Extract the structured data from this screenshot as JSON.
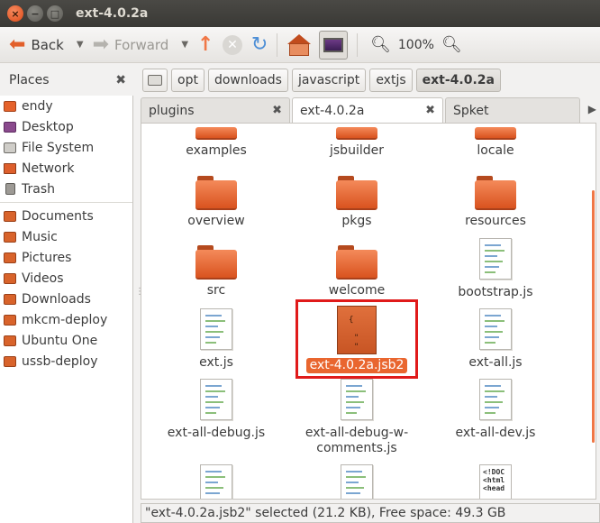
{
  "window": {
    "title": "ext-4.0.2a"
  },
  "toolbar": {
    "back_label": "Back",
    "forward_label": "Forward",
    "zoom_level": "100%"
  },
  "sidebar": {
    "header": "Places",
    "items": [
      {
        "label": "endy",
        "icon": "home-folder-icon"
      },
      {
        "label": "Desktop",
        "icon": "desktop-icon"
      },
      {
        "label": "File System",
        "icon": "harddisk-icon"
      },
      {
        "label": "Network",
        "icon": "network-icon"
      },
      {
        "label": "Trash",
        "icon": "trash-icon"
      }
    ],
    "bookmarks": [
      {
        "label": "Documents"
      },
      {
        "label": "Music"
      },
      {
        "label": "Pictures"
      },
      {
        "label": "Videos"
      },
      {
        "label": "Downloads"
      },
      {
        "label": "mkcm-deploy"
      },
      {
        "label": "Ubuntu One"
      },
      {
        "label": "ussb-deploy"
      }
    ]
  },
  "pathbar": {
    "crumbs": [
      "opt",
      "downloads",
      "javascript",
      "extjs",
      "ext-4.0.2a"
    ]
  },
  "tabs": [
    {
      "label": "plugins"
    },
    {
      "label": "ext-4.0.2a"
    },
    {
      "label": "Spket"
    }
  ],
  "files": [
    {
      "name": "examples",
      "type": "folder"
    },
    {
      "name": "jsbuilder",
      "type": "folder"
    },
    {
      "name": "locale",
      "type": "folder"
    },
    {
      "name": "overview",
      "type": "folder"
    },
    {
      "name": "pkgs",
      "type": "folder"
    },
    {
      "name": "resources",
      "type": "folder"
    },
    {
      "name": "src",
      "type": "folder"
    },
    {
      "name": "welcome",
      "type": "folder"
    },
    {
      "name": "bootstrap.js",
      "type": "js"
    },
    {
      "name": "ext.js",
      "type": "js"
    },
    {
      "name": "ext-4.0.2a.jsb2",
      "type": "jsb2",
      "selected": true
    },
    {
      "name": "ext-all.js",
      "type": "js"
    },
    {
      "name": "ext-all-debug.js",
      "type": "js"
    },
    {
      "name": "ext-all-debug-w-comments.js",
      "name_line1": "ext-all-debug-w-",
      "name_line2": "comments.js",
      "type": "js"
    },
    {
      "name": "ext-all-dev.js",
      "type": "js"
    }
  ],
  "html_preview_text": "<!DOC\n<html\n<head",
  "status": {
    "text": "\"ext-4.0.2a.jsb2\" selected (21.2 KB), Free space: 49.3 GB"
  },
  "colors": {
    "accent": "#e9662f",
    "titlebar": "#3c3b37",
    "highlight_box": "#e01a1a"
  }
}
